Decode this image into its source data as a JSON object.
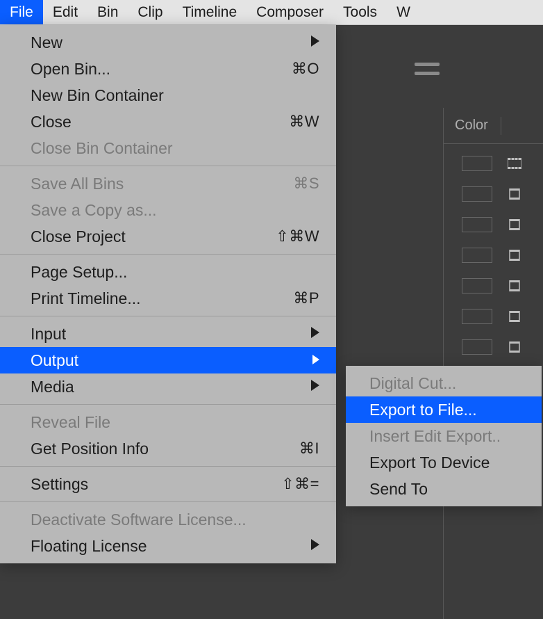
{
  "menubar": {
    "items": [
      {
        "label": "File",
        "active": true
      },
      {
        "label": "Edit",
        "active": false
      },
      {
        "label": "Bin",
        "active": false
      },
      {
        "label": "Clip",
        "active": false
      },
      {
        "label": "Timeline",
        "active": false
      },
      {
        "label": "Composer",
        "active": false
      },
      {
        "label": "Tools",
        "active": false
      },
      {
        "label": "W",
        "active": false
      }
    ]
  },
  "file_menu": {
    "groups": [
      [
        {
          "label": "New",
          "shortcut": "",
          "submenu": true,
          "disabled": false
        },
        {
          "label": "Open Bin...",
          "shortcut": "⌘O",
          "submenu": false,
          "disabled": false
        },
        {
          "label": "New Bin Container",
          "shortcut": "",
          "submenu": false,
          "disabled": false
        },
        {
          "label": "Close",
          "shortcut": "⌘W",
          "submenu": false,
          "disabled": false
        },
        {
          "label": "Close Bin Container",
          "shortcut": "",
          "submenu": false,
          "disabled": true
        }
      ],
      [
        {
          "label": "Save All Bins",
          "shortcut": "⌘S",
          "submenu": false,
          "disabled": true
        },
        {
          "label": "Save a Copy as...",
          "shortcut": "",
          "submenu": false,
          "disabled": true
        },
        {
          "label": "Close Project",
          "shortcut": "⇧⌘W",
          "submenu": false,
          "disabled": false
        }
      ],
      [
        {
          "label": "Page Setup...",
          "shortcut": "",
          "submenu": false,
          "disabled": false
        },
        {
          "label": "Print Timeline...",
          "shortcut": "⌘P",
          "submenu": false,
          "disabled": false
        }
      ],
      [
        {
          "label": "Input",
          "shortcut": "",
          "submenu": true,
          "disabled": false
        },
        {
          "label": "Output",
          "shortcut": "",
          "submenu": true,
          "disabled": false,
          "highlighted": true
        },
        {
          "label": "Media",
          "shortcut": "",
          "submenu": true,
          "disabled": false
        }
      ],
      [
        {
          "label": "Reveal File",
          "shortcut": "",
          "submenu": false,
          "disabled": true
        },
        {
          "label": "Get Position Info",
          "shortcut": "⌘I",
          "submenu": false,
          "disabled": false
        }
      ],
      [
        {
          "label": "Settings",
          "shortcut": "⇧⌘=",
          "submenu": false,
          "disabled": false
        }
      ],
      [
        {
          "label": "Deactivate Software License...",
          "shortcut": "",
          "submenu": false,
          "disabled": true
        },
        {
          "label": "Floating License",
          "shortcut": "",
          "submenu": true,
          "disabled": false
        }
      ]
    ]
  },
  "output_submenu": {
    "items": [
      {
        "label": "Digital Cut...",
        "disabled": true,
        "highlighted": false
      },
      {
        "label": "Export to File...",
        "disabled": false,
        "highlighted": true
      },
      {
        "label": "Insert Edit Export..",
        "disabled": true,
        "highlighted": false
      },
      {
        "label": "Export To Device",
        "disabled": false,
        "highlighted": false
      },
      {
        "label": "Send To",
        "disabled": false,
        "highlighted": false
      }
    ]
  },
  "side_panel": {
    "header": "Color",
    "rows": [
      {
        "icon": "master"
      },
      {
        "icon": "sub"
      },
      {
        "icon": "sub"
      },
      {
        "icon": "sub"
      },
      {
        "icon": "sub"
      },
      {
        "icon": "sub"
      },
      {
        "icon": "sub"
      },
      {
        "icon": "sub"
      },
      {
        "icon": "sub"
      },
      {
        "icon": "sub"
      }
    ]
  }
}
